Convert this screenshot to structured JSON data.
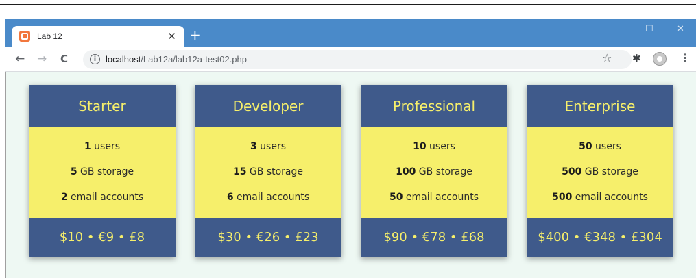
{
  "browser": {
    "tab_title": "Lab 12",
    "tab_close": "✕",
    "new_tab": "+",
    "minimize": "—",
    "maximize": "☐",
    "close": "✕",
    "back": "←",
    "forward": "→",
    "reload": "C",
    "url_host": "localhost",
    "url_path": "/Lab12a/lab12a-test02.php",
    "bookmark_star": "☆",
    "extensions": "✱",
    "menu": "⋮"
  },
  "plans": [
    {
      "name": "Starter",
      "users": "1",
      "users_label": " users",
      "storage": "5",
      "storage_label": " GB storage",
      "email": "2",
      "email_label": " email accounts",
      "price": "$10 • €9 • £8"
    },
    {
      "name": "Developer",
      "users": "3",
      "users_label": " users",
      "storage": "15",
      "storage_label": " GB storage",
      "email": "6",
      "email_label": " email accounts",
      "price": "$30 • €26 • £23"
    },
    {
      "name": "Professional",
      "users": "10",
      "users_label": " users",
      "storage": "100",
      "storage_label": " GB storage",
      "email": "50",
      "email_label": " email accounts",
      "price": "$90 • €78 • £68"
    },
    {
      "name": "Enterprise",
      "users": "50",
      "users_label": " users",
      "storage": "500",
      "storage_label": " GB storage",
      "email": "500",
      "email_label": " email accounts",
      "price": "$400 • €348 • £304"
    }
  ],
  "colors": {
    "card_header": "#3f5a8b",
    "card_body": "#f6ef6b",
    "accent_text": "#f6ef6b",
    "page_background": "#eef8f3",
    "titlebar": "#4a8ac9"
  }
}
